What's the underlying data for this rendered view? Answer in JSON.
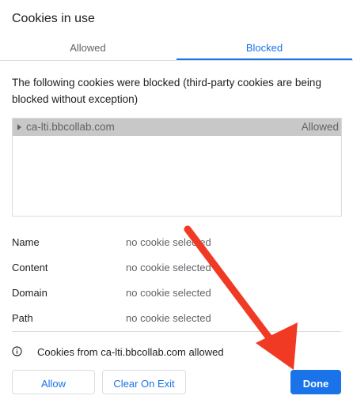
{
  "dialog": {
    "title": "Cookies in use"
  },
  "tabs": [
    {
      "label": "Allowed",
      "selected": false
    },
    {
      "label": "Blocked",
      "selected": true
    }
  ],
  "description": "The following cookies were blocked (third-party cookies are being blocked without exception)",
  "cookie_list": [
    {
      "domain": "ca-lti.bbcollab.com",
      "status": "Allowed",
      "selected": true
    }
  ],
  "details": [
    {
      "label": "Name",
      "value": "no cookie selected"
    },
    {
      "label": "Content",
      "value": "no cookie selected"
    },
    {
      "label": "Domain",
      "value": "no cookie selected"
    },
    {
      "label": "Path",
      "value": "no cookie selected"
    }
  ],
  "info": {
    "icon": "info-icon",
    "text": "Cookies from ca-lti.bbcollab.com allowed"
  },
  "buttons": {
    "allow": "Allow",
    "clear_on_exit": "Clear On Exit",
    "done": "Done"
  },
  "colors": {
    "accent": "#1a73e8",
    "annotation_arrow": "#f03a24",
    "selected_row": "#c8c8c8"
  }
}
